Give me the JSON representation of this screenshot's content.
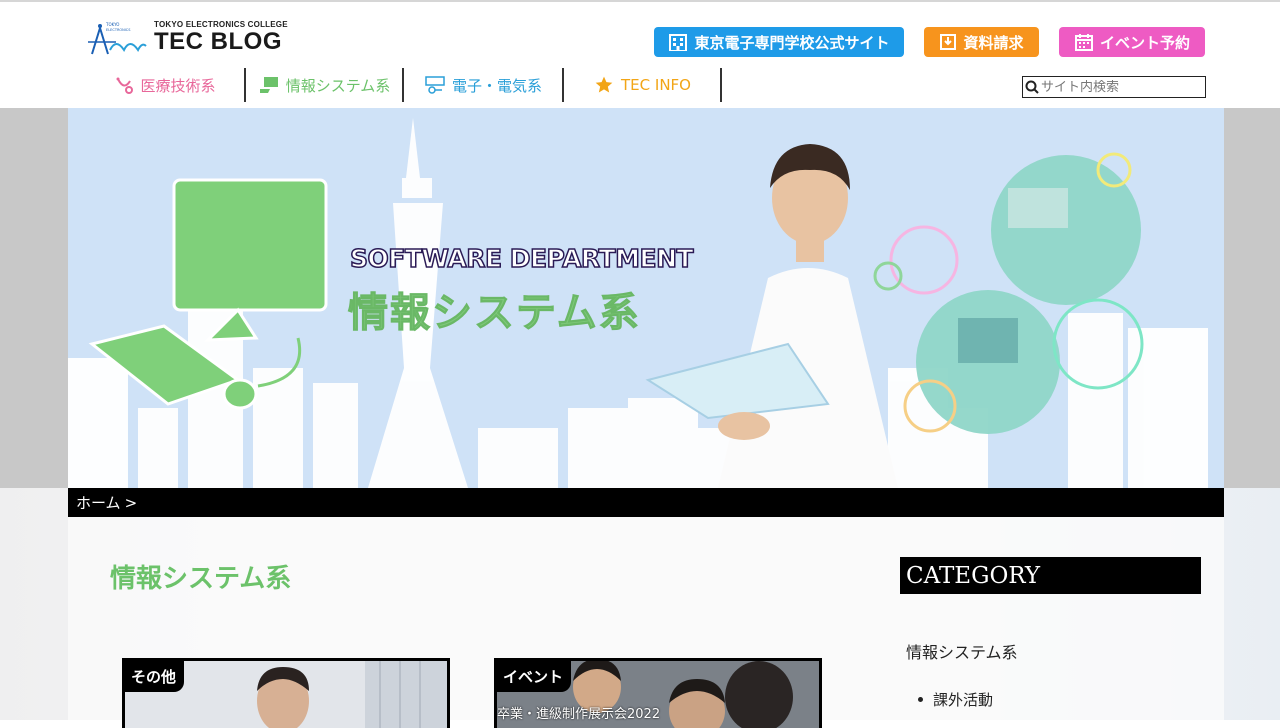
{
  "header": {
    "logo_sub": "TOKYO ELECTRONICS COLLEGE",
    "logo_main": "TEC BLOG",
    "buttons": {
      "official": "東京電子専門学校公式サイト",
      "document": "資料請求",
      "event": "イベント予約"
    },
    "search_placeholder": "サイト内検索"
  },
  "nav": {
    "items": [
      {
        "label": "医療技術系",
        "color": "#e8679a"
      },
      {
        "label": "情報システム系",
        "color": "#6cc26a"
      },
      {
        "label": "電子・電気系",
        "color": "#2a9fd8"
      },
      {
        "label": "TEC INFO",
        "color": "#f2a516"
      }
    ]
  },
  "hero": {
    "subtitle": "SOFTWARE DEPARTMENT",
    "title": "情報システム系"
  },
  "breadcrumb": {
    "home": "ホーム",
    "separator": ">"
  },
  "main": {
    "page_title": "情報システム系",
    "cards": [
      {
        "tag": "その他",
        "overlay": ""
      },
      {
        "tag": "イベント",
        "overlay": "卒業・進級制作展示会2022"
      }
    ]
  },
  "sidebar": {
    "heading": "CATEGORY",
    "category": "情報システム系",
    "subitem": "課外活動"
  },
  "colors": {
    "official_btn": "#1e9be8",
    "doc_btn": "#f7941d",
    "event_btn": "#ee5bc3",
    "hero_bg": "#cfe2f7",
    "accent_green": "#6cc26a"
  }
}
